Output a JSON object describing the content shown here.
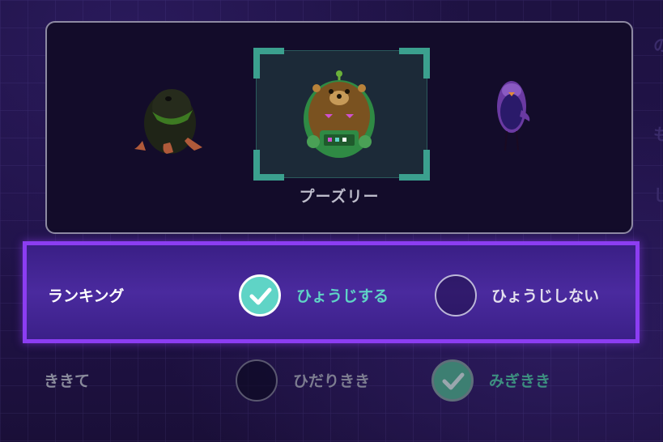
{
  "character": {
    "selected_name": "プーズリー",
    "characters": [
      "platypus",
      "robot-bear",
      "purple-bird"
    ]
  },
  "settings": {
    "ranking": {
      "label": "ランキング",
      "options": [
        {
          "label": "ひょうじする",
          "selected": true
        },
        {
          "label": "ひょうじしない",
          "selected": false
        }
      ]
    },
    "handedness": {
      "label": "ききて",
      "options": [
        {
          "label": "ひだりきき",
          "selected": false
        },
        {
          "label": "みぎきき",
          "selected": true
        }
      ]
    }
  },
  "colors": {
    "highlight_border": "#8c3df2",
    "selected_radio": "#5fd4c6",
    "selected_text": "#5fd4c6",
    "selector_frame": "#3ba08e"
  },
  "icons": [
    "check-icon"
  ]
}
